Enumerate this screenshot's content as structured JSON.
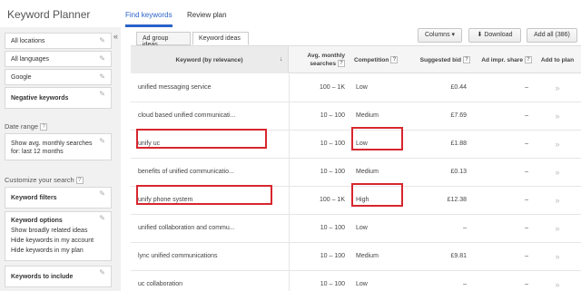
{
  "app": {
    "title": "Keyword Planner"
  },
  "top_tabs": [
    {
      "label": "Find keywords",
      "active": true
    },
    {
      "label": "Review plan",
      "active": false
    }
  ],
  "sidebar": {
    "collapse_icon": "«",
    "locations": "All locations",
    "languages": "All languages",
    "network": "Google",
    "negative_keywords": "Negative keywords",
    "date_range_label": "Date range",
    "date_range_line1": "Show avg. monthly searches",
    "date_range_line2": "for: last 12 months",
    "customize_label": "Customize your search",
    "keyword_filters": "Keyword filters",
    "keyword_options": {
      "title": "Keyword options",
      "lines": [
        "Show broadly related ideas",
        "Hide keywords in my account",
        "Hide keywords in my plan"
      ]
    },
    "keywords_to_include": "Keywords to include",
    "help": "?"
  },
  "main": {
    "sub_tabs": [
      {
        "label": "Ad group ideas",
        "active": false
      },
      {
        "label": "Keyword ideas",
        "active": true
      }
    ],
    "toolbar": {
      "columns": "Columns ▾",
      "download": "Download",
      "add_all": "Add all (386)"
    },
    "headers": {
      "keyword": "Keyword (by relevance)",
      "searches_line1": "Avg. monthly",
      "searches_line2": "searches",
      "competition": "Competition",
      "bid": "Suggested bid",
      "impr": "Ad impr. share",
      "add": "Add to plan",
      "help": "?",
      "sort_icon": "↓"
    },
    "rows": [
      {
        "keyword": "unified messaging service",
        "searches": "100 – 1K",
        "competition": "Low",
        "bid": "£0.44",
        "impr": "–",
        "add": "»"
      },
      {
        "keyword": "cloud based unified communicati...",
        "searches": "10 – 100",
        "competition": "Medium",
        "bid": "£7.69",
        "impr": "–",
        "add": "»"
      },
      {
        "keyword": "unify uc",
        "searches": "10 – 100",
        "competition": "Low",
        "bid": "£1.88",
        "impr": "–",
        "add": "»"
      },
      {
        "keyword": "benefits of unified communicatio...",
        "searches": "10 – 100",
        "competition": "Medium",
        "bid": "£0.13",
        "impr": "–",
        "add": "»"
      },
      {
        "keyword": "unify phone system",
        "searches": "100 – 1K",
        "competition": "High",
        "bid": "£12.38",
        "impr": "–",
        "add": "»"
      },
      {
        "keyword": "unified collaboration and commu...",
        "searches": "10 – 100",
        "competition": "Low",
        "bid": "–",
        "impr": "–",
        "add": "»"
      },
      {
        "keyword": "lync unified communications",
        "searches": "10 – 100",
        "competition": "Medium",
        "bid": "£9.81",
        "impr": "–",
        "add": "»"
      },
      {
        "keyword": "uc collaboration",
        "searches": "10 – 100",
        "competition": "Low",
        "bid": "–",
        "impr": "–",
        "add": "»"
      }
    ]
  },
  "colors": {
    "accent": "#2a62c9",
    "highlight": "#d8262e",
    "sidebar_bg": "#f1f1f1"
  }
}
